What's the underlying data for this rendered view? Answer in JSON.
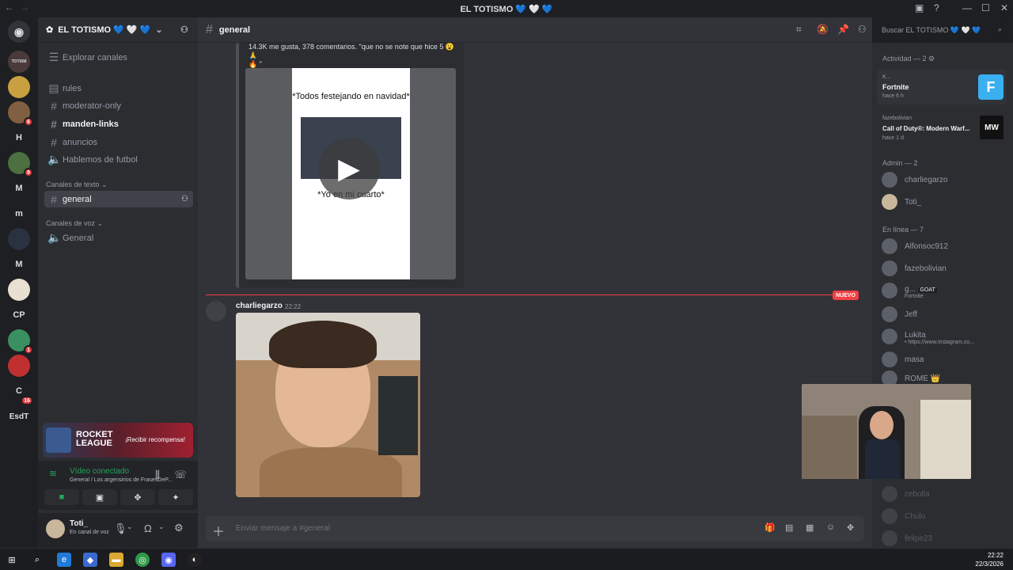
{
  "window": {
    "title": "EL TOTISMO 💙 🤍 💙"
  },
  "server_rail": {
    "icons": [
      {
        "label": "",
        "badge": ""
      },
      {
        "label": "TOTISM",
        "badge": ""
      },
      {
        "label": "",
        "badge": ""
      },
      {
        "label": "",
        "badge": "6"
      },
      {
        "label": "H",
        "badge": ""
      },
      {
        "label": "",
        "badge": "9"
      },
      {
        "label": "M",
        "badge": ""
      },
      {
        "label": "m",
        "badge": ""
      },
      {
        "label": "",
        "badge": ""
      },
      {
        "label": "M",
        "badge": ""
      },
      {
        "label": "",
        "badge": ""
      },
      {
        "label": "CP",
        "badge": ""
      },
      {
        "label": "",
        "badge": "1"
      },
      {
        "label": "",
        "badge": ""
      },
      {
        "label": "C",
        "badge": "16"
      },
      {
        "label": "EsdT",
        "badge": ""
      }
    ]
  },
  "sidebar": {
    "server_name": "EL TOTISMO 💙 🤍 💙",
    "explore": "Explorar canales",
    "channels": [
      {
        "name": "rules"
      },
      {
        "name": "moderator-only"
      },
      {
        "name": "manden-links"
      },
      {
        "name": "anuncios"
      },
      {
        "name": "Hablemos de futbol"
      }
    ],
    "text_category": "Canales de texto",
    "text_channel": "general",
    "voice_category": "Canales de voz",
    "voice_channel": "General"
  },
  "promo": {
    "game": "ROCKET LEAGUE",
    "cta": "¡Recibir recompensa!"
  },
  "voice_panel": {
    "status": "Vídeo conectado",
    "location": "General / Los argensirios de FrasesDeP..."
  },
  "user_panel": {
    "name": "Toti_",
    "status": "En canal de voz"
  },
  "chat_header": {
    "channel": "general",
    "search_placeholder": "Buscar EL TOTISMO 💙 🤍 💙"
  },
  "embed": {
    "caption": "14.3K me gusta, 378 comentarios. \"que no se note que hice 5 😮 🙏",
    "caption2": "🔥 \"",
    "video_top_text": "*Todos festejando en navidad*",
    "video_bottom_text": "*Yo en mi cuarto*"
  },
  "new_marker": "NUEVO",
  "message": {
    "author": "charliegarzo",
    "time": "22:22"
  },
  "composer": {
    "placeholder": "Enviar mensaje a #general"
  },
  "members": {
    "activity_header": "Actividad — 2",
    "activities": [
      {
        "user": "K...",
        "game": "Fortnite",
        "time": "hace 6 h",
        "tile": "F"
      },
      {
        "user": "fazebolivian",
        "game": "Call of Duty®: Modern Warf...",
        "time": "hace 1 d",
        "tile": "MW"
      }
    ],
    "admin_header": "Admin — 2",
    "admins": [
      {
        "name": "charliegarzo"
      },
      {
        "name": "Toti_"
      }
    ],
    "online_header": "En línea — 7",
    "online": [
      {
        "name": "Alfonsoc912",
        "sub": ""
      },
      {
        "name": "fazebolivian",
        "sub": ""
      },
      {
        "name": "g...",
        "sub": "Fortnite",
        "tag": "GOAT"
      },
      {
        "name": "Jeff",
        "sub": ""
      },
      {
        "name": "Lukita",
        "sub": "• https://www.instagram.co..."
      },
      {
        "name": "masa",
        "sub": ""
      },
      {
        "name": "ROME 👑",
        "sub": ""
      }
    ],
    "offline": [
      {
        "name": "cebolla"
      },
      {
        "name": "Chulo"
      },
      {
        "name": "felipe23"
      }
    ]
  },
  "taskbar": {
    "time": "22:22",
    "date": "22/3/2026"
  }
}
